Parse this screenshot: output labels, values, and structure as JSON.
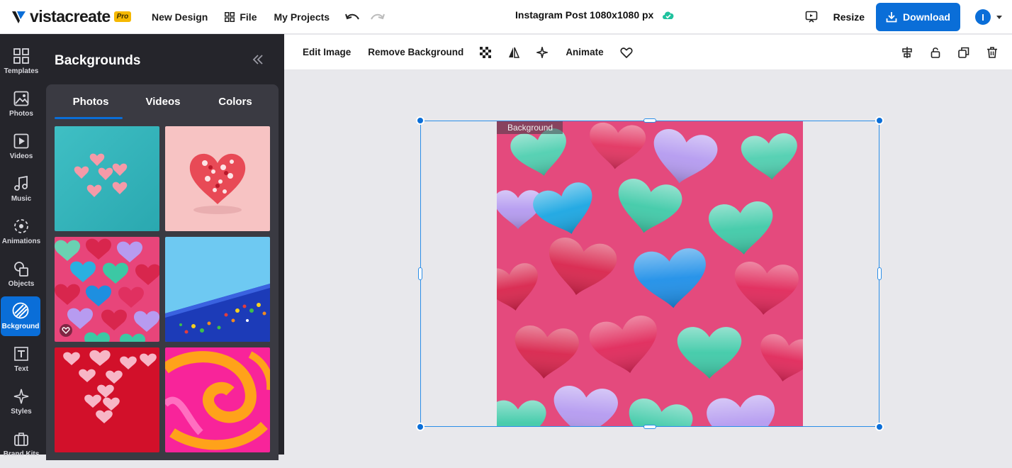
{
  "app": {
    "logo_text": "vistacreate",
    "pro_badge": "Pro",
    "menu": {
      "new_design": "New Design",
      "file": "File",
      "my_projects": "My Projects"
    },
    "document_title": "Instagram Post 1080x1080 px",
    "resize_label": "Resize",
    "download_label": "Download",
    "avatar_initial": "I",
    "brand_color": "#0a6ed8"
  },
  "sidebar": {
    "items": [
      {
        "label": "Templates",
        "icon": "templates-icon"
      },
      {
        "label": "Photos",
        "icon": "photos-icon"
      },
      {
        "label": "Videos",
        "icon": "videos-icon"
      },
      {
        "label": "Music",
        "icon": "music-icon"
      },
      {
        "label": "Animations",
        "icon": "animations-icon"
      },
      {
        "label": "Objects",
        "icon": "objects-icon"
      },
      {
        "label": "Bckground",
        "icon": "background-icon",
        "active": true
      },
      {
        "label": "Text",
        "icon": "text-icon"
      },
      {
        "label": "Styles",
        "icon": "styles-icon"
      },
      {
        "label": "Brand Kits",
        "icon": "brand-kits-icon"
      }
    ]
  },
  "panel": {
    "title": "Backgrounds",
    "tabs": [
      {
        "label": "Photos",
        "active": true
      },
      {
        "label": "Videos",
        "active": false
      },
      {
        "label": "Colors",
        "active": false
      }
    ],
    "thumbnails": [
      {
        "name": "thumb-pink-hearts-on-teal"
      },
      {
        "name": "thumb-candy-heart-on-pink"
      },
      {
        "name": "thumb-foil-chocolate-hearts",
        "favorite_badge": true
      },
      {
        "name": "thumb-blue-sprinkles"
      },
      {
        "name": "thumb-paper-hearts-on-red"
      },
      {
        "name": "thumb-pink-orange-swirl"
      }
    ]
  },
  "context_toolbar": {
    "edit_image": "Edit Image",
    "remove_background": "Remove Background",
    "animate": "Animate"
  },
  "canvas": {
    "background_tag": "Background"
  }
}
